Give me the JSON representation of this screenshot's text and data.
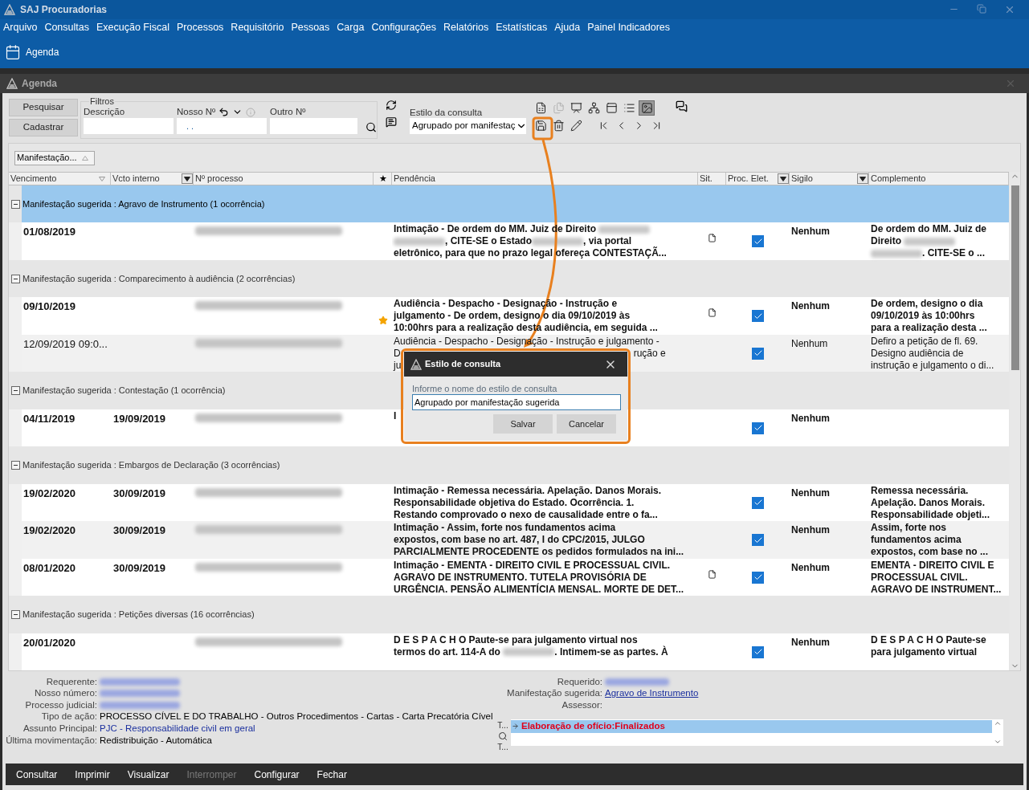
{
  "window": {
    "title": "SAJ Procuradorias"
  },
  "menu": [
    "Arquivo",
    "Consultas",
    "Execução Fiscal",
    "Processos",
    "Requisitório",
    "Pessoas",
    "Carga",
    "Configurações",
    "Relatórios",
    "Estatísticas",
    "Ajuda",
    "Painel Indicadores"
  ],
  "quick_launch": {
    "label": "Agenda"
  },
  "subwindow": {
    "title": "Agenda"
  },
  "toolbar": {
    "buttons": [
      "Pesquisar",
      "Cadastrar"
    ],
    "filters": {
      "legend": "Filtros",
      "fields": [
        {
          "label": "Descrição"
        },
        {
          "label": "Nosso Nº",
          "value": ". ."
        },
        {
          "label": "Outro Nº"
        }
      ]
    },
    "style_label": "Estilo da consulta",
    "style_value": "Agrupado por manifestaç",
    "tools_row_1": [
      {
        "kind": "excel",
        "disabled": false,
        "selected": false
      },
      {
        "kind": "copy",
        "disabled": true,
        "selected": false
      },
      {
        "kind": "export",
        "disabled": false,
        "selected": false
      },
      {
        "kind": "tree",
        "disabled": false,
        "selected": false
      },
      {
        "kind": "panel",
        "disabled": false,
        "selected": false
      },
      {
        "kind": "list",
        "disabled": false,
        "selected": false
      },
      {
        "kind": "preview",
        "disabled": false,
        "selected": true
      }
    ],
    "tools_row_2": [
      {
        "kind": "save",
        "disabled": false,
        "selected": false
      },
      {
        "kind": "delete",
        "disabled": false,
        "selected": false
      },
      {
        "kind": "edit",
        "disabled": false,
        "selected": false
      },
      {
        "kind": "first",
        "disabled": false,
        "selected": false
      },
      {
        "kind": "prev",
        "disabled": false,
        "selected": false
      },
      {
        "kind": "next",
        "disabled": false,
        "selected": false
      },
      {
        "kind": "last",
        "disabled": false,
        "selected": false
      }
    ]
  },
  "group_by": {
    "label": "Manifestação..."
  },
  "table": {
    "columns": [
      {
        "label": "Vencimento",
        "sorted": true,
        "filter": false
      },
      {
        "label": "Vcto interno",
        "sorted": false,
        "filter": true
      },
      {
        "label": "Nº processo",
        "sorted": false,
        "filter": false
      },
      {
        "label": "★",
        "sorted": false,
        "filter": false
      },
      {
        "label": "Pendência",
        "sorted": false,
        "filter": false
      },
      {
        "label": "Sit.",
        "sorted": false,
        "filter": false
      },
      {
        "label": "Proc. Elet.",
        "sorted": false,
        "filter": true
      },
      {
        "label": "Sigilo",
        "sorted": false,
        "filter": true
      },
      {
        "label": "Complemento",
        "sorted": false,
        "filter": false
      }
    ],
    "groups": [
      {
        "title": "Manifestação sugerida : Agravo de Instrumento (1 ocorrência)",
        "selected": true,
        "expanded": true,
        "rows": [
          {
            "vencimento": "01/08/2019",
            "bold": true,
            "starred": false,
            "document": true,
            "electronic": true,
            "sigilo": "Nenhum",
            "pendencia": [
              [
                {
                  "text": "Intimação - De ordem do MM. Juiz de Direito "
                },
                {
                  "kind": "redacted"
                }
              ],
              [
                {
                  "kind": "redacted"
                },
                {
                  "text": ", CITE-SE o Estado"
                },
                {
                  "kind": "redacted"
                },
                {
                  "text": ", via portal"
                }
              ],
              [
                {
                  "text": "eletrônico, para que no prazo legal ofereça CONTESTAÇÃ..."
                }
              ]
            ],
            "complemento": [
              [
                {
                  "text": "De ordem do MM. Juiz de"
                }
              ],
              [
                {
                  "text": "Direito "
                },
                {
                  "kind": "redacted"
                }
              ],
              [
                {
                  "kind": "redacted"
                },
                {
                  "text": ". CITE-SE o ..."
                }
              ]
            ]
          }
        ]
      },
      {
        "title": "Manifestação sugerida : Comparecimento à audiência (2 ocorrências)",
        "selected": false,
        "expanded": true,
        "rows": [
          {
            "vencimento": "09/10/2019",
            "bold": true,
            "starred": true,
            "document": true,
            "electronic": true,
            "sigilo": "Nenhum",
            "pendencia": [
              [
                {
                  "text": "Audiência - Despacho - Designação - Instrução e"
                }
              ],
              [
                {
                  "text": "julgamento - De ordem, designo o dia 09/10/2019 às"
                }
              ],
              [
                {
                  "text": "10:00hrs para a realização desta audiência, em seguida ..."
                }
              ]
            ],
            "complemento": [
              [
                {
                  "text": "De ordem, designo o dia"
                }
              ],
              [
                {
                  "text": "09/10/2019 às 10:00hrs"
                }
              ],
              [
                {
                  "text": "para a realização desta ..."
                }
              ]
            ]
          },
          {
            "vencimento": "12/09/2019 09:0...",
            "bold": false,
            "starred": false,
            "document": false,
            "electronic": true,
            "sigilo": "Nenhum",
            "pendencia": [
              [
                {
                  "text": "Audiência - Despacho - Designação - Instrução e julgamento -"
                }
              ],
              [
                {
                  "text": "D"
                },
                {
                  "kind": "covered"
                },
                {
                  "text": "rução e"
                }
              ],
              [
                {
                  "text": "ju"
                }
              ]
            ],
            "complemento": [
              [
                {
                  "text": "Defiro a petição de fl. 69."
                }
              ],
              [
                {
                  "text": "Designo audiência de"
                }
              ],
              [
                {
                  "text": "instrução e julgamento o di..."
                }
              ]
            ]
          }
        ]
      },
      {
        "title": "Manifestação sugerida : Contestação (1 ocorrência)",
        "selected": false,
        "expanded": true,
        "rows": [
          {
            "vencimento": "04/11/2019",
            "vcto_interno": "19/09/2019",
            "bold": true,
            "starred": false,
            "document": false,
            "electronic": true,
            "sigilo": "Nenhum",
            "pendencia": [
              [
                {
                  "text": "I"
                }
              ]
            ],
            "complemento": []
          }
        ]
      },
      {
        "title": "Manifestação sugerida : Embargos de Declaração (3 ocorrências)",
        "selected": false,
        "expanded": true,
        "rows": [
          {
            "vencimento": "19/02/2020",
            "vcto_interno": "30/09/2019",
            "bold": true,
            "starred": false,
            "document": false,
            "electronic": true,
            "sigilo": "Nenhum",
            "pendencia": [
              [
                {
                  "text": "Intimação - Remessa necessária. Apelação. Danos Morais."
                }
              ],
              [
                {
                  "text": "Responsabilidade objetiva do Estado. Ocorrência. 1."
                }
              ],
              [
                {
                  "text": "Restando comprovado o nexo de causalidade entre o fa..."
                }
              ]
            ],
            "complemento": [
              [
                {
                  "text": "Remessa necessária."
                }
              ],
              [
                {
                  "text": "Apelação. Danos Morais."
                }
              ],
              [
                {
                  "text": "Responsabilidade objeti..."
                }
              ]
            ]
          },
          {
            "vencimento": "19/02/2020",
            "vcto_interno": "30/09/2019",
            "bold": true,
            "starred": false,
            "document": false,
            "electronic": true,
            "sigilo": "Nenhum",
            "pendencia": [
              [
                {
                  "text": "Intimação - Assim, forte nos fundamentos acima"
                }
              ],
              [
                {
                  "text": "expostos, com base no art. 487, I do CPC/2015, JULGO"
                }
              ],
              [
                {
                  "text": "PARCIALMENTE PROCEDENTE os pedidos formulados na ini..."
                }
              ]
            ],
            "complemento": [
              [
                {
                  "text": "Assim, forte nos"
                }
              ],
              [
                {
                  "text": "fundamentos acima"
                }
              ],
              [
                {
                  "text": "expostos, com base no ..."
                }
              ]
            ]
          },
          {
            "vencimento": "08/01/2020",
            "vcto_interno": "30/09/2019",
            "bold": true,
            "starred": false,
            "document": true,
            "electronic": true,
            "sigilo": "Nenhum",
            "pendencia": [
              [
                {
                  "text": "Intimação - EMENTA - DIREITO CIVIL E PROCESSUAL CIVIL."
                }
              ],
              [
                {
                  "text": "AGRAVO DE INSTRUMENTO. TUTELA PROVISÓRIA DE"
                }
              ],
              [
                {
                  "text": "URGÊNCIA. PENSÃO ALIMENTÍCIA MENSAL. MORTE DE DET..."
                }
              ]
            ],
            "complemento": [
              [
                {
                  "text": "EMENTA - DIREITO CIVIL E"
                }
              ],
              [
                {
                  "text": "PROCESSUAL CIVIL."
                }
              ],
              [
                {
                  "text": "AGRAVO DE INSTRUMENT..."
                }
              ]
            ]
          }
        ]
      },
      {
        "title": "Manifestação sugerida : Petições diversas (16 ocorrências)",
        "selected": false,
        "expanded": true,
        "rows": [
          {
            "vencimento": "20/01/2020",
            "bold": true,
            "starred": false,
            "document": false,
            "electronic": true,
            "sigilo": "Nenhum",
            "pendencia": [
              [
                {
                  "text": "D E S P A C H O Paute-se para julgamento virtual nos"
                }
              ],
              [
                {
                  "text": "termos do art. 114-A do "
                },
                {
                  "kind": "redacted"
                },
                {
                  "text": ". Intimem-se as partes. À"
                }
              ]
            ],
            "complemento": [
              [
                {
                  "text": "D E S P A C H O Paute-se"
                }
              ],
              [
                {
                  "text": "para julgamento virtual"
                }
              ]
            ]
          }
        ]
      }
    ]
  },
  "details": {
    "left": [
      {
        "label": "Requerente:",
        "kind": "redacted"
      },
      {
        "label": "Nosso número:",
        "kind": "redacted"
      },
      {
        "label": "Processo judicial:",
        "kind": "redacted"
      },
      {
        "label": "Tipo de ação:",
        "kind": "text",
        "value": "PROCESSO CÍVEL E DO TRABALHO - Outros Procedimentos - Cartas - Carta Precatória Cível"
      },
      {
        "label": "Assunto Principal:",
        "kind": "link",
        "value": "PJC - Responsabilidade civil em geral"
      },
      {
        "label": "Última movimentação:",
        "kind": "text",
        "value": "Redistribuição - Automática"
      }
    ],
    "right": [
      {
        "label": "Requerido:",
        "kind": "redacted"
      },
      {
        "label": "Manifestação sugerida:",
        "kind": "link",
        "value": "Agravo de Instrumento"
      },
      {
        "label": "Assessor:",
        "kind": "empty"
      }
    ],
    "side_labels": [
      "T...",
      "T..."
    ],
    "list": [
      {
        "text": "Elaboração de ofício:Finalizados",
        "selected": true
      }
    ]
  },
  "actions": [
    {
      "label": "Consultar",
      "disabled": false
    },
    {
      "label": "Imprimir",
      "disabled": false
    },
    {
      "label": "Visualizar",
      "disabled": false
    },
    {
      "label": "Interromper",
      "disabled": true
    },
    {
      "label": "Configurar",
      "disabled": false
    },
    {
      "label": "Fechar",
      "disabled": false
    }
  ],
  "dialog": {
    "title": "Estilo de consulta",
    "label": "Informe o nome do estilo de consulta",
    "value": "Agrupado por manifestação sugerida",
    "buttons": [
      "Salvar",
      "Cancelar"
    ]
  }
}
